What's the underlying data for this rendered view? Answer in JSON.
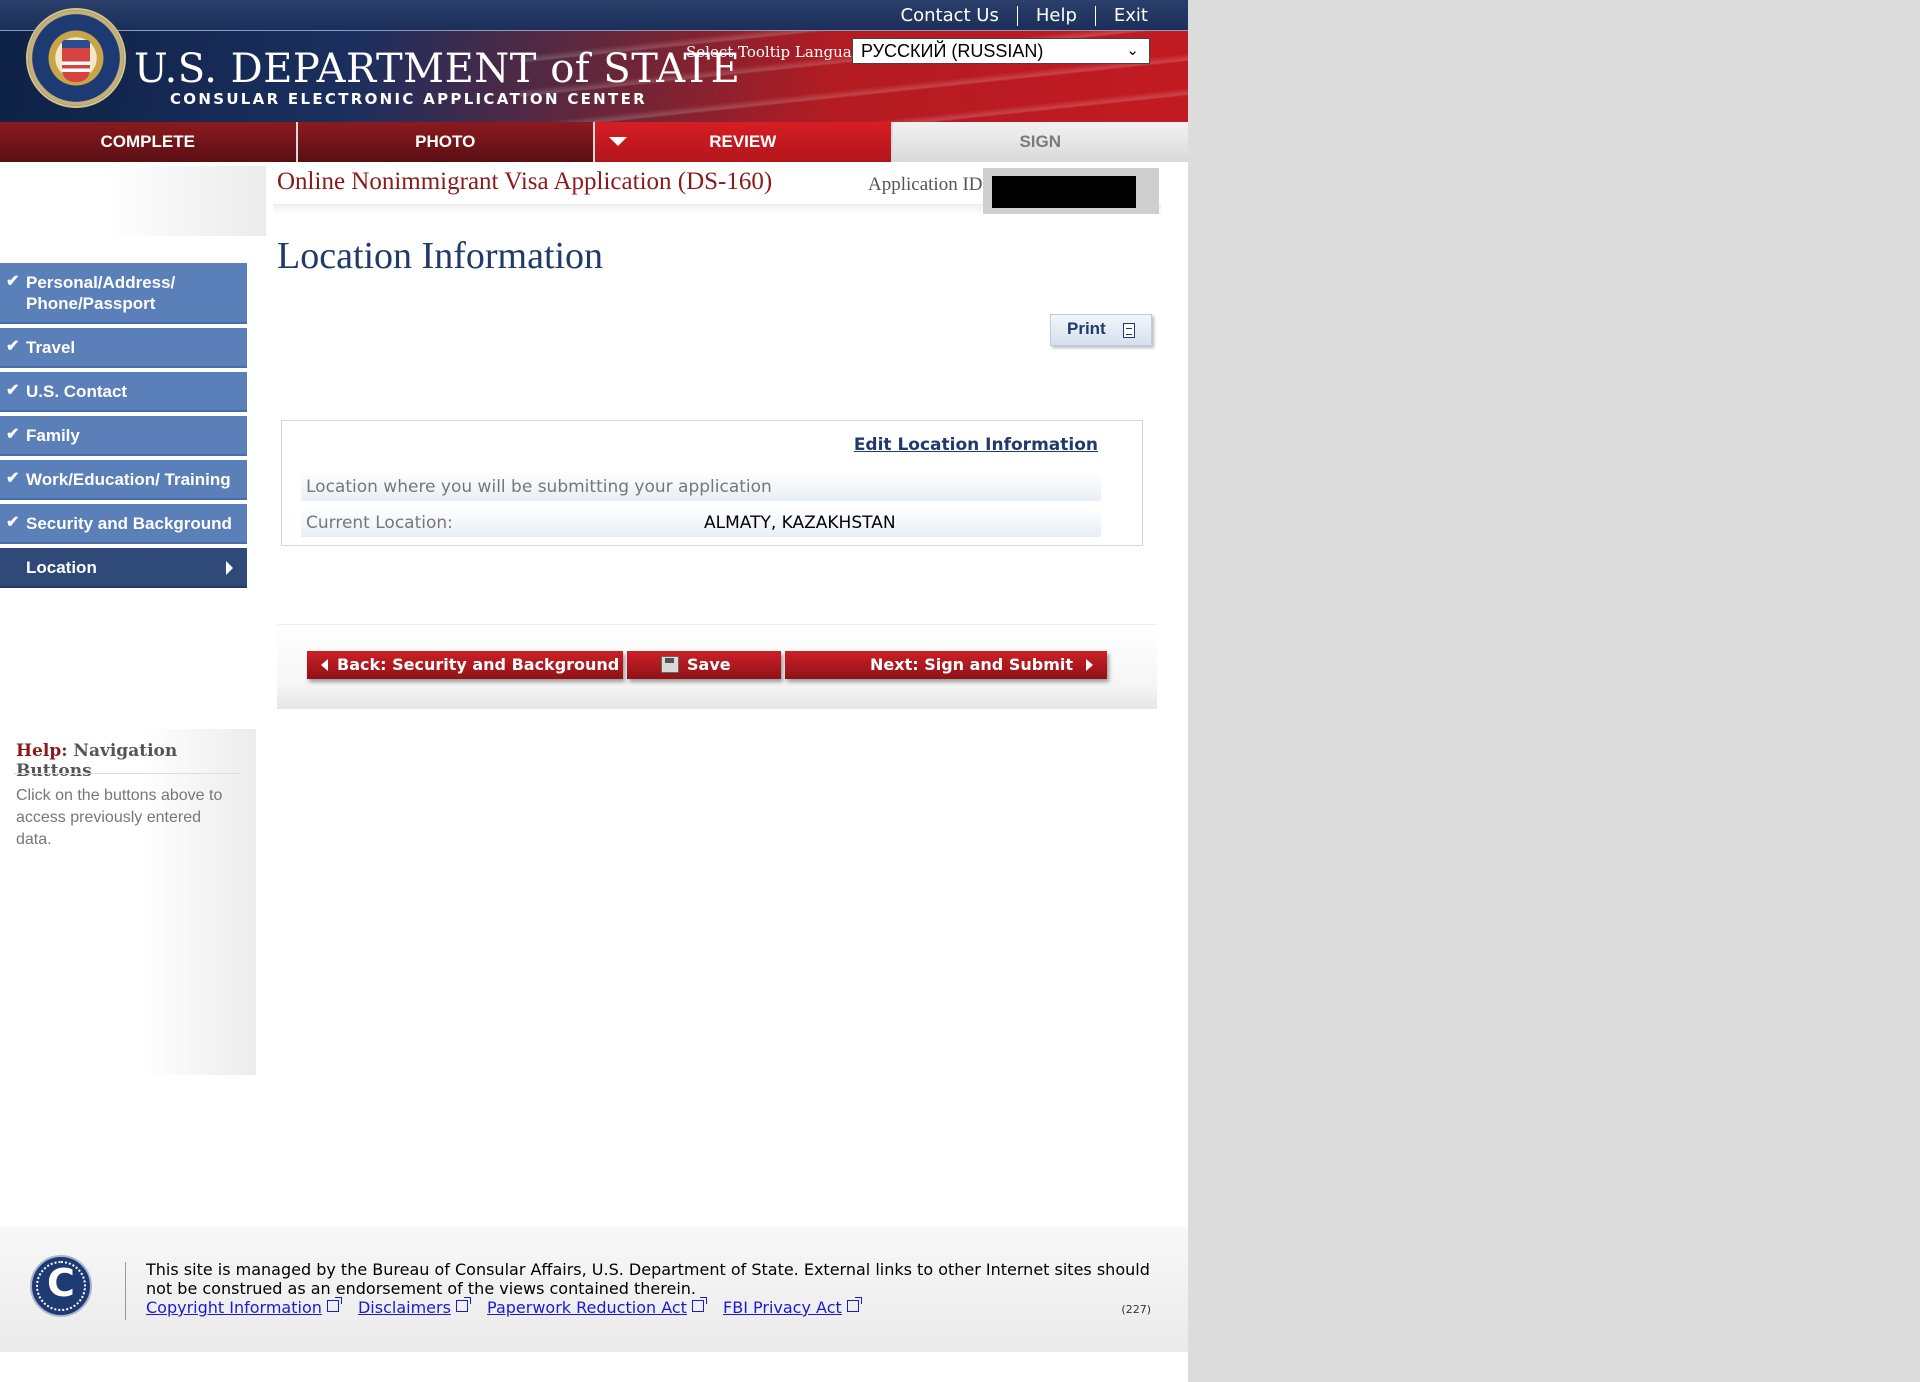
{
  "header": {
    "top_links": [
      "Contact Us",
      "Help",
      "Exit"
    ],
    "org_title": "U.S. DEPARTMENT of STATE",
    "org_subtitle": "CONSULAR ELECTRONIC APPLICATION CENTER",
    "tooltip_language_label": "Select Tooltip Language",
    "tooltip_language_value": "РУССКИЙ (RUSSIAN)",
    "seal_icon": "department-of-state-seal"
  },
  "steps": [
    {
      "label": "COMPLETE",
      "state": "done"
    },
    {
      "label": "PHOTO",
      "state": "done"
    },
    {
      "label": "REVIEW",
      "state": "active"
    },
    {
      "label": "SIGN",
      "state": "todo"
    }
  ],
  "application": {
    "title": "Online Nonimmigrant Visa Application (DS-160)",
    "id_label": "Application ID",
    "id_value_redacted": true
  },
  "sidebar": {
    "items": [
      {
        "label": "Personal/Address/ Phone/Passport",
        "completed": true
      },
      {
        "label": "Travel",
        "completed": true
      },
      {
        "label": "U.S. Contact",
        "completed": true
      },
      {
        "label": "Family",
        "completed": true
      },
      {
        "label": "Work/Education/ Training",
        "completed": true
      },
      {
        "label": "Security and Background",
        "completed": true
      },
      {
        "label": "Location",
        "current": true
      }
    ],
    "help": {
      "label": "Help:",
      "topic": "Navigation Buttons",
      "text": "Click on the buttons above to access previously entered data."
    }
  },
  "main": {
    "heading": "Location Information",
    "print_label": "Print",
    "edit_link": "Edit Location Information",
    "section_caption": "Location where you will be submitting your application",
    "current_location_label": "Current Location:",
    "current_location_value": "ALMATY, KAZAKHSTAN"
  },
  "nav_buttons": {
    "back": "Back: Security and Background",
    "save": "Save",
    "next": "Next: Sign and Submit"
  },
  "footer": {
    "text": "This site is managed by the Bureau of Consular Affairs, U.S. Department of State. External links to other Internet sites should not be construed as an endorsement of the views contained therein.",
    "links": [
      "Copyright Information",
      "Disclaimers",
      "Paperwork Reduction Act",
      "FBI Privacy Act"
    ],
    "build": "(227)"
  },
  "colors": {
    "header_blue": "#1b2f5e",
    "header_red": "#c31a22",
    "nav_blue": "#5b7fb8",
    "nav_current": "#2f4a78",
    "title_red": "#8b1a1a",
    "heading_blue": "#1f3a6b",
    "button_red": "#b8181f"
  }
}
